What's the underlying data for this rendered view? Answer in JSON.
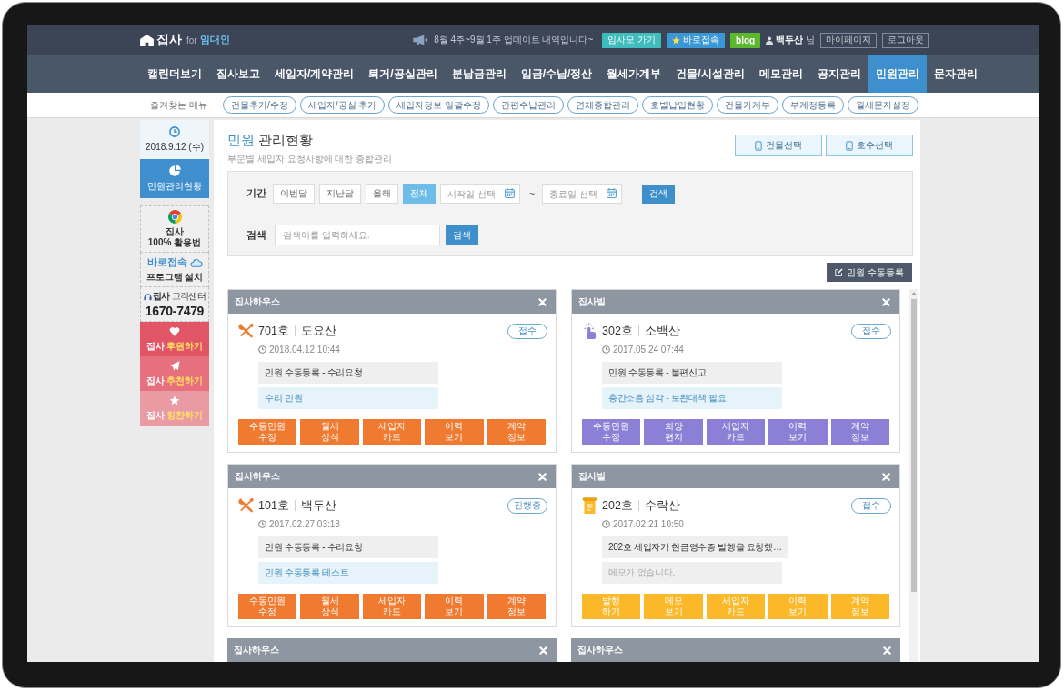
{
  "header": {
    "logo": {
      "name": "집사",
      "for": "for",
      "audience": "임대인"
    },
    "notice": "8월 4주~9월 1주 업데이트 내역입니다~",
    "buttons": [
      {
        "kind": "community",
        "label": "임사모 가기",
        "color": "#3fbcbc"
      },
      {
        "kind": "shortcut",
        "label": "바로접속",
        "color": "#3b98d6"
      },
      {
        "kind": "blog",
        "label": "blog",
        "color": "#5cb82c"
      }
    ],
    "user": "**백두산** 님",
    "links": [
      "마이페이지",
      "로그아웃"
    ]
  },
  "nav": [
    {
      "label": "캘린더보기",
      "selected": false
    },
    {
      "label": "집사보고",
      "selected": false
    },
    {
      "label": "세입자/계약관리",
      "selected": false
    },
    {
      "label": "퇴거/공실관리",
      "selected": false
    },
    {
      "label": "분납금관리",
      "selected": false
    },
    {
      "label": "입금/수납/정산",
      "selected": false
    },
    {
      "label": "월세가계부",
      "selected": false
    },
    {
      "label": "건물/시설관리",
      "selected": false
    },
    {
      "label": "메모관리",
      "selected": false
    },
    {
      "label": "공지관리",
      "selected": false
    },
    {
      "label": "민원관리",
      "selected": true
    },
    {
      "label": "문자관리",
      "selected": false
    }
  ],
  "favorites": {
    "label": "즐겨찾는 메뉴",
    "items": [
      "건물추가/수정",
      "세입자/공실 추가",
      "세입자정보 일괄수정",
      "간편수납관리",
      "연체종합관리",
      "호별납입현황",
      "건물가계부",
      "부계정등록",
      "월세문자설정"
    ]
  },
  "sidebar": {
    "date": "2018.9.12 (수)",
    "current": "민원관리현황",
    "guide": "집사\n100% 활용법",
    "install": {
      "title": "바로접속",
      "subtitle": "프로그램 설치"
    },
    "support": {
      "title": "**집사** 고객센터",
      "phone": "1670-7479"
    },
    "actions": [
      {
        "kind": "donate",
        "prefix": "집사",
        "label": "후원하기"
      },
      {
        "kind": "recommend",
        "prefix": "집사",
        "label": "추천하기"
      },
      {
        "kind": "praise",
        "prefix": "집사",
        "label": "칭찬하기"
      }
    ]
  },
  "page": {
    "title_accent": "민원",
    "title": "관리현황",
    "subtitle": "부문별 세입자 요청사항에 대한 종합관리",
    "selectors": [
      "건물선택",
      "호수선택"
    ]
  },
  "filter": {
    "period_label": "기간",
    "periods": [
      {
        "label": "이번달",
        "selected": false
      },
      {
        "label": "지난달",
        "selected": false
      },
      {
        "label": "올해",
        "selected": false
      },
      {
        "label": "전체",
        "selected": true
      }
    ],
    "start": {
      "placeholder": "시작일 선택"
    },
    "separator": "~",
    "end": {
      "placeholder": "종료일 선택"
    },
    "period_search": "검색",
    "search_label": "검색",
    "search": {
      "placeholder": "검색어를 입력하세요."
    },
    "search_button": "검색"
  },
  "register_button": "민원 수동등록",
  "cards": [
    {
      "building": "집사하우스",
      "kind": "repair",
      "room": "701호",
      "tenant": "도요산",
      "status": "접수",
      "date": "2018.04.12 10:44",
      "title": "민원 수동등록 - 수리요청",
      "memo": "수리 민원",
      "memo_missing": false,
      "actions": [
        "수동민원\n수정",
        "월세\n상식",
        "세입자\n카드",
        "이력\n보기",
        "계약\n정보"
      ]
    },
    {
      "building": "집사빌",
      "kind": "complaint",
      "room": "302호",
      "tenant": "소백산",
      "status": "접수",
      "date": "2017.05.24 07:44",
      "title": "민원 수동등록 - 불편신고",
      "memo": "층간소음 심각 - 보완대책 필요",
      "memo_missing": false,
      "actions": [
        "수동민원\n수정",
        "희망\n편지",
        "세입자\n카드",
        "이력\n보기",
        "계약\n정보"
      ]
    },
    {
      "building": "집사하우스",
      "kind": "repair",
      "room": "101호",
      "tenant": "백두산",
      "status": "진행중",
      "date": "2017.02.27 03:18",
      "title": "민원 수동등록 - 수리요청",
      "memo": "민원 수동등록 테스트",
      "memo_missing": false,
      "actions": [
        "수동민원\n수정",
        "월세\n상식",
        "세입자\n카드",
        "이력\n보기",
        "계약\n정보"
      ]
    },
    {
      "building": "집사빌",
      "kind": "receipt",
      "room": "202호",
      "tenant": "수락산",
      "status": "접수",
      "date": "2017.02.21 10:50",
      "title": "202호 세입자가 현금영수증 발행을 요청했…",
      "memo": "메모가 없습니다.",
      "memo_missing": true,
      "actions": [
        "발행\n하기",
        "메모\n보기",
        "세입자\n카드",
        "이력\n보기",
        "계약\n정보"
      ]
    },
    {
      "building": "집사하우스"
    },
    {
      "building": "집사하우스"
    }
  ]
}
